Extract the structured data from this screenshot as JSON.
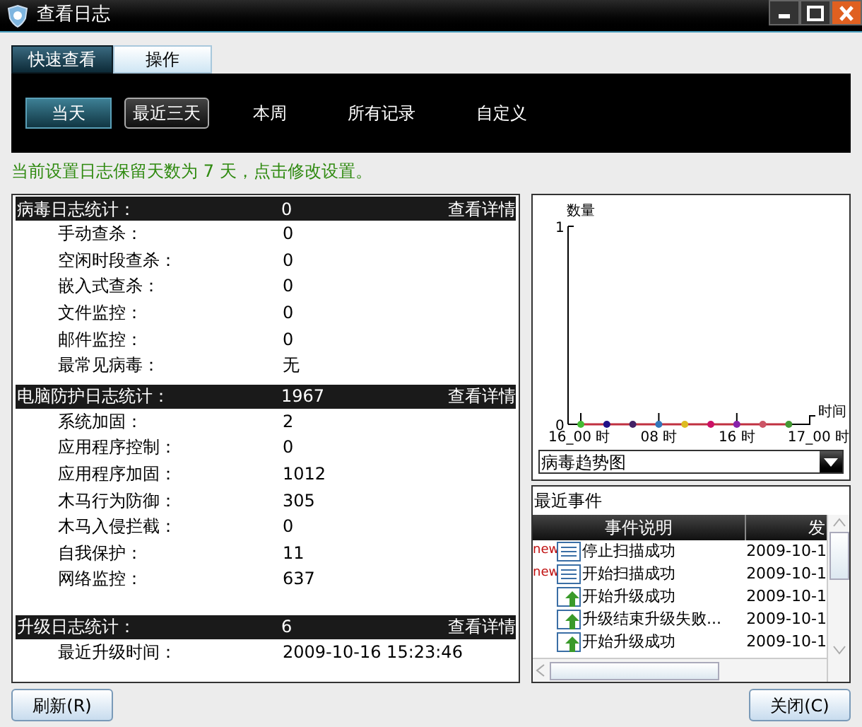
{
  "window": {
    "title": "查看日志"
  },
  "tabs": [
    {
      "label": "快速查看",
      "selected": true
    },
    {
      "label": "操作",
      "selected": false
    }
  ],
  "ranges": [
    {
      "label": "当天",
      "kind": "button",
      "selected": true
    },
    {
      "label": "最近三天",
      "kind": "button",
      "selected": false
    },
    {
      "label": "本周",
      "kind": "link",
      "selected": false
    },
    {
      "label": "所有记录",
      "kind": "link",
      "selected": false
    },
    {
      "label": "自定义",
      "kind": "link",
      "selected": false
    }
  ],
  "notice": "当前设置日志保留天数为 7 天，点击修改设置。",
  "sections": [
    {
      "label": "病毒日志统计：",
      "value": "0",
      "link": "查看详情",
      "items": [
        {
          "label": "手动查杀：",
          "value": "0"
        },
        {
          "label": "空闲时段查杀：",
          "value": "0"
        },
        {
          "label": "嵌入式查杀：",
          "value": "0"
        },
        {
          "label": "文件监控：",
          "value": "0"
        },
        {
          "label": "邮件监控：",
          "value": "0"
        },
        {
          "label": "最常见病毒：",
          "value": "无"
        }
      ]
    },
    {
      "label": "电脑防护日志统计：",
      "value": "1967",
      "link": "查看详情",
      "items": [
        {
          "label": "系统加固：",
          "value": "2"
        },
        {
          "label": "应用程序控制：",
          "value": "0"
        },
        {
          "label": "应用程序加固：",
          "value": "1012"
        },
        {
          "label": "木马行为防御：",
          "value": "305"
        },
        {
          "label": "木马入侵拦截：",
          "value": "0"
        },
        {
          "label": "自我保护：",
          "value": "11"
        },
        {
          "label": "网络监控：",
          "value": "637"
        }
      ]
    },
    {
      "label": "升级日志统计：",
      "value": "6",
      "link": "查看详情",
      "items": [
        {
          "label": "最近升级时间：",
          "value": "2009-10-16 15:23:46"
        }
      ]
    }
  ],
  "trend": {
    "chart_data": {
      "type": "line",
      "xlabel": "时间",
      "ylabel": "数量",
      "categories": [
        "16_00 时",
        null,
        null,
        "08 时",
        null,
        null,
        "16 时",
        null,
        null,
        "17_00 时"
      ],
      "series": [
        {
          "color": "#c03040",
          "marker": "circle",
          "values": [
            0,
            0,
            0,
            0,
            0,
            0,
            0,
            0,
            0,
            null
          ]
        }
      ],
      "ylim": [
        0,
        1
      ],
      "yticks": [
        0,
        1
      ]
    },
    "dropdown": "病毒趋势图"
  },
  "events": {
    "title": "最近事件",
    "columns": [
      "事件说明",
      "发"
    ],
    "rows": [
      {
        "badge": "new",
        "kind": "scan",
        "description": "停止扫描成功",
        "time": "2009-10-1"
      },
      {
        "badge": "new",
        "kind": "scan",
        "description": "开始扫描成功",
        "time": "2009-10-1"
      },
      {
        "kind": "upgrade",
        "description": "开始升级成功",
        "time": "2009-10-1"
      },
      {
        "kind": "upgrade",
        "description": "升级结束升级失败...",
        "time": "2009-10-1"
      },
      {
        "kind": "upgrade",
        "description": "开始升级成功",
        "time": "2009-10-1"
      }
    ]
  },
  "buttons": [
    {
      "label": "刷新(R)"
    },
    {
      "label": "关闭(C)"
    }
  ]
}
